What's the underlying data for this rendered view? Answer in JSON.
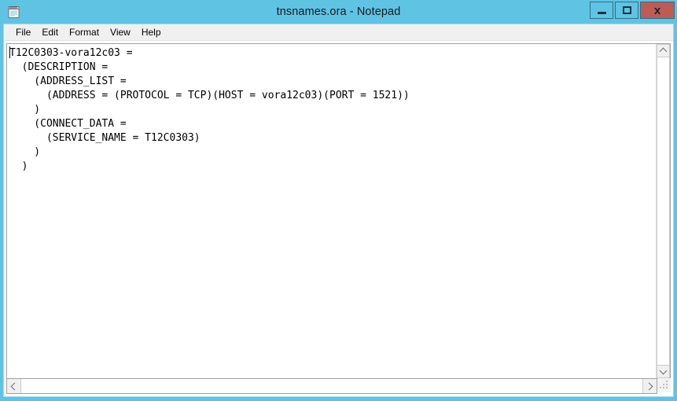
{
  "window": {
    "title": "tnsnames.ora - Notepad",
    "app_icon": "notepad-icon",
    "chrome_color": "#5FC3E4",
    "close_button_color": "#BE5B56",
    "controls": {
      "minimize_label": "–",
      "maximize_label": "□",
      "close_label": "x"
    }
  },
  "menubar": {
    "items": [
      {
        "label": "File"
      },
      {
        "label": "Edit"
      },
      {
        "label": "Format"
      },
      {
        "label": "View"
      },
      {
        "label": "Help"
      }
    ]
  },
  "editor": {
    "filename": "tnsnames.ora",
    "caret_line": 1,
    "caret_column": 1,
    "word_wrap": false,
    "lines": [
      "T12C0303-vora12c03 =",
      "  (DESCRIPTION =",
      "    (ADDRESS_LIST =",
      "      (ADDRESS = (PROTOCOL = TCP)(HOST = vora12c03)(PORT = 1521))",
      "    )",
      "    (CONNECT_DATA =",
      "      (SERVICE_NAME = T12C0303)",
      "    )",
      "  )"
    ],
    "text": "T12C0303-vora12c03 =\n  (DESCRIPTION =\n    (ADDRESS_LIST =\n      (ADDRESS = (PROTOCOL = TCP)(HOST = vora12c03)(PORT = 1521))\n    )\n    (CONNECT_DATA =\n      (SERVICE_NAME = T12C0303)\n    )\n  )"
  },
  "scrollbars": {
    "vertical": {
      "up_arrow": "chevron-up-icon",
      "down_arrow": "chevron-down-icon"
    },
    "horizontal": {
      "left_arrow": "chevron-left-icon",
      "right_arrow": "chevron-right-icon"
    },
    "resize_grip": "resize-grip-icon"
  }
}
